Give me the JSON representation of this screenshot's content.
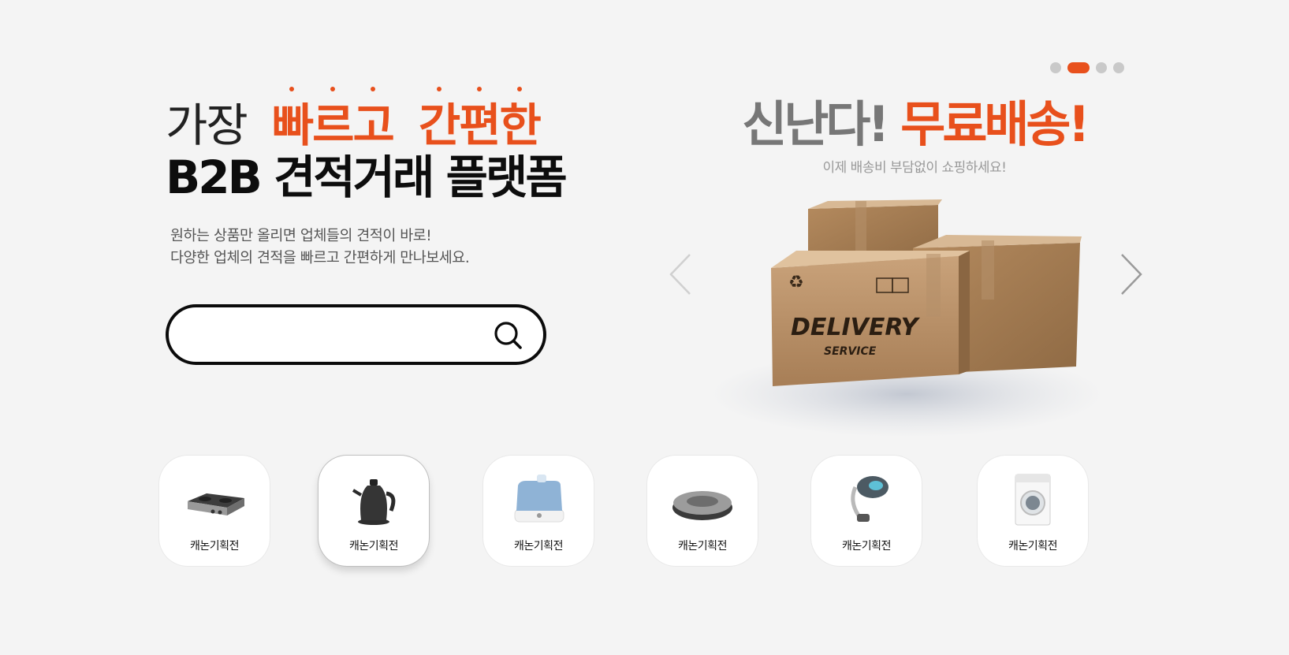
{
  "hero": {
    "line1_word1": "가장",
    "line1_word2": "빠르고",
    "line1_word3": "간편한",
    "line2": "B2B 견적거래 플랫폼",
    "desc_line1": "원하는 상품만 올리면 업체들의 견적이 바로!",
    "desc_line2": "다양한 업체의 견적을 빠르고 간편하게 만나보세요."
  },
  "search": {
    "placeholder": "",
    "value": ""
  },
  "banner": {
    "title_gray": "신난다!",
    "title_orange": "무료배송!",
    "subtitle": "이제 배송비 부담없이 쇼핑하세요!",
    "box_label": "DELIVERY",
    "box_sublabel": "SERVICE",
    "slide_count": 4,
    "active_slide": 2
  },
  "categories": [
    {
      "label": "캐논기획전",
      "icon": "gas-stove-icon"
    },
    {
      "label": "캐논기획전",
      "icon": "electric-kettle-icon"
    },
    {
      "label": "캐논기획전",
      "icon": "humidifier-icon"
    },
    {
      "label": "캐논기획전",
      "icon": "robot-vacuum-icon"
    },
    {
      "label": "캐논기획전",
      "icon": "steam-iron-icon"
    },
    {
      "label": "캐논기획전",
      "icon": "washing-machine-icon"
    }
  ],
  "colors": {
    "accent": "#e8501c",
    "background": "#f4f4f4",
    "text": "#111111"
  }
}
